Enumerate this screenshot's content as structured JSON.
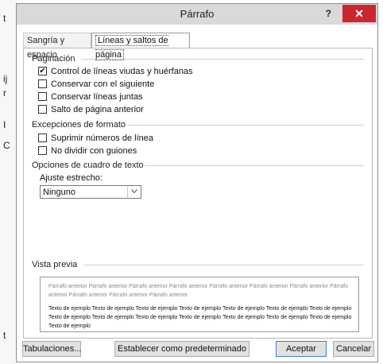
{
  "background_chars": [
    "t",
    "ij",
    "r",
    "I",
    "C",
    "t"
  ],
  "dialog": {
    "title": "Párrafo",
    "help_glyph": "?",
    "close_glyph": "✕",
    "tabs": [
      {
        "label": "Sangría y espacio",
        "active": false
      },
      {
        "label": "Líneas y saltos de página",
        "active": true
      }
    ],
    "pagination": {
      "heading": "Paginación",
      "options": [
        {
          "label": "Control de líneas viudas y huérfanas",
          "checked": true
        },
        {
          "label": "Conservar con el siguiente",
          "checked": false
        },
        {
          "label": "Conservar líneas juntas",
          "checked": false
        },
        {
          "label": "Salto de página anterior",
          "checked": false
        }
      ]
    },
    "format_exceptions": {
      "heading": "Excepciones de formato",
      "options": [
        {
          "label": "Suprimir números de línea",
          "checked": false
        },
        {
          "label": "No dividir con guiones",
          "checked": false
        }
      ]
    },
    "textbox_options": {
      "heading": "Opciones de cuadro de texto",
      "tight_wrap_label": "Ajuste estrecho:",
      "tight_wrap_value": "Ninguno"
    },
    "preview": {
      "heading": "Vista previa",
      "previous_text": "Párrafo anterior Párrafo anterior Párrafo anterior Párrafo anterior Párrafo anterior Párrafo anterior Párrafo anterior Párrafo anterior Párrafo anterior Párrafo anterior Párrafo anterior",
      "sample_text": "Texto de ejemplo Texto de ejemplo Texto de ejemplo Texto de ejemplo Texto de ejemplo Texto de ejemplo Texto de ejemplo Texto de ejemplo Texto de ejemplo Texto de ejemplo Texto de ejemplo Texto de ejemplo Texto de ejemplo Texto de ejemplo Texto de ejemplo"
    },
    "buttons": {
      "tabs_label": "Tabulaciones...",
      "default_label": "Establecer como predeterminado",
      "ok_label": "Aceptar",
      "cancel_label": "Cancelar"
    }
  },
  "colors": {
    "close_button": "#c8282e",
    "titlebar": "#d9d9d9",
    "primary_border": "#3c7fd1"
  }
}
